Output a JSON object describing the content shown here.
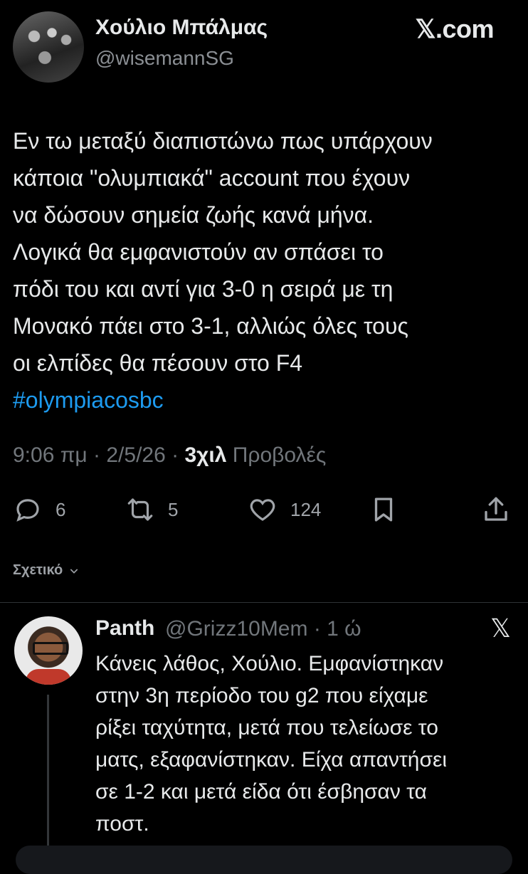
{
  "tweet": {
    "author_name": "Χούλιο Μπάλμας",
    "author_handle": "@wisemannSG",
    "site_label": "𝕏.com",
    "body_lines": [
      "Εν τω μεταξύ διαπιστώνω πως υπάρχουν",
      "κάποια \"ολυμπιακά\" account που έχουν",
      "να δώσουν σημεία ζωής κανά μήνα.",
      "Λογικά θα εμφανιστούν αν σπάσει το",
      "πόδι του και αντί για 3-0 η σειρά με τη",
      "Μονακό πάει στο 3-1, αλλιώς όλες τους",
      "οι ελπίδες θα πέσουν στο F4"
    ],
    "hashtag": "#olympiacosbc",
    "time": "9:06 πμ · 2/5/26 · ",
    "views_count": "3χιλ",
    "views_label": " Προβολές",
    "actions": {
      "replies": "6",
      "reposts": "5",
      "likes": "124"
    }
  },
  "related_label": "Σχετικό",
  "reply": {
    "author_name": "Panth",
    "meta": "@Grizz10Mem · 1 ώ",
    "close_glyph": "𝕏",
    "body_lines": [
      "Κάνεις λάθος, Χούλιο. Εμφανίστηκαν",
      "στην 3η περίοδο του g2 που είχαμε",
      "ρίξει ταχύτητα, μετά που τελείωσε το",
      "ματς, εξαφανίστηκαν. Είχα απαντήσει",
      "σε 1-2 και μετά είδα ότι έσβησαν τα",
      "ποστ."
    ]
  },
  "colors": {
    "background": "#000000",
    "text": "#e7e9ea",
    "secondary": "#71767b",
    "link": "#1d9bf0"
  }
}
